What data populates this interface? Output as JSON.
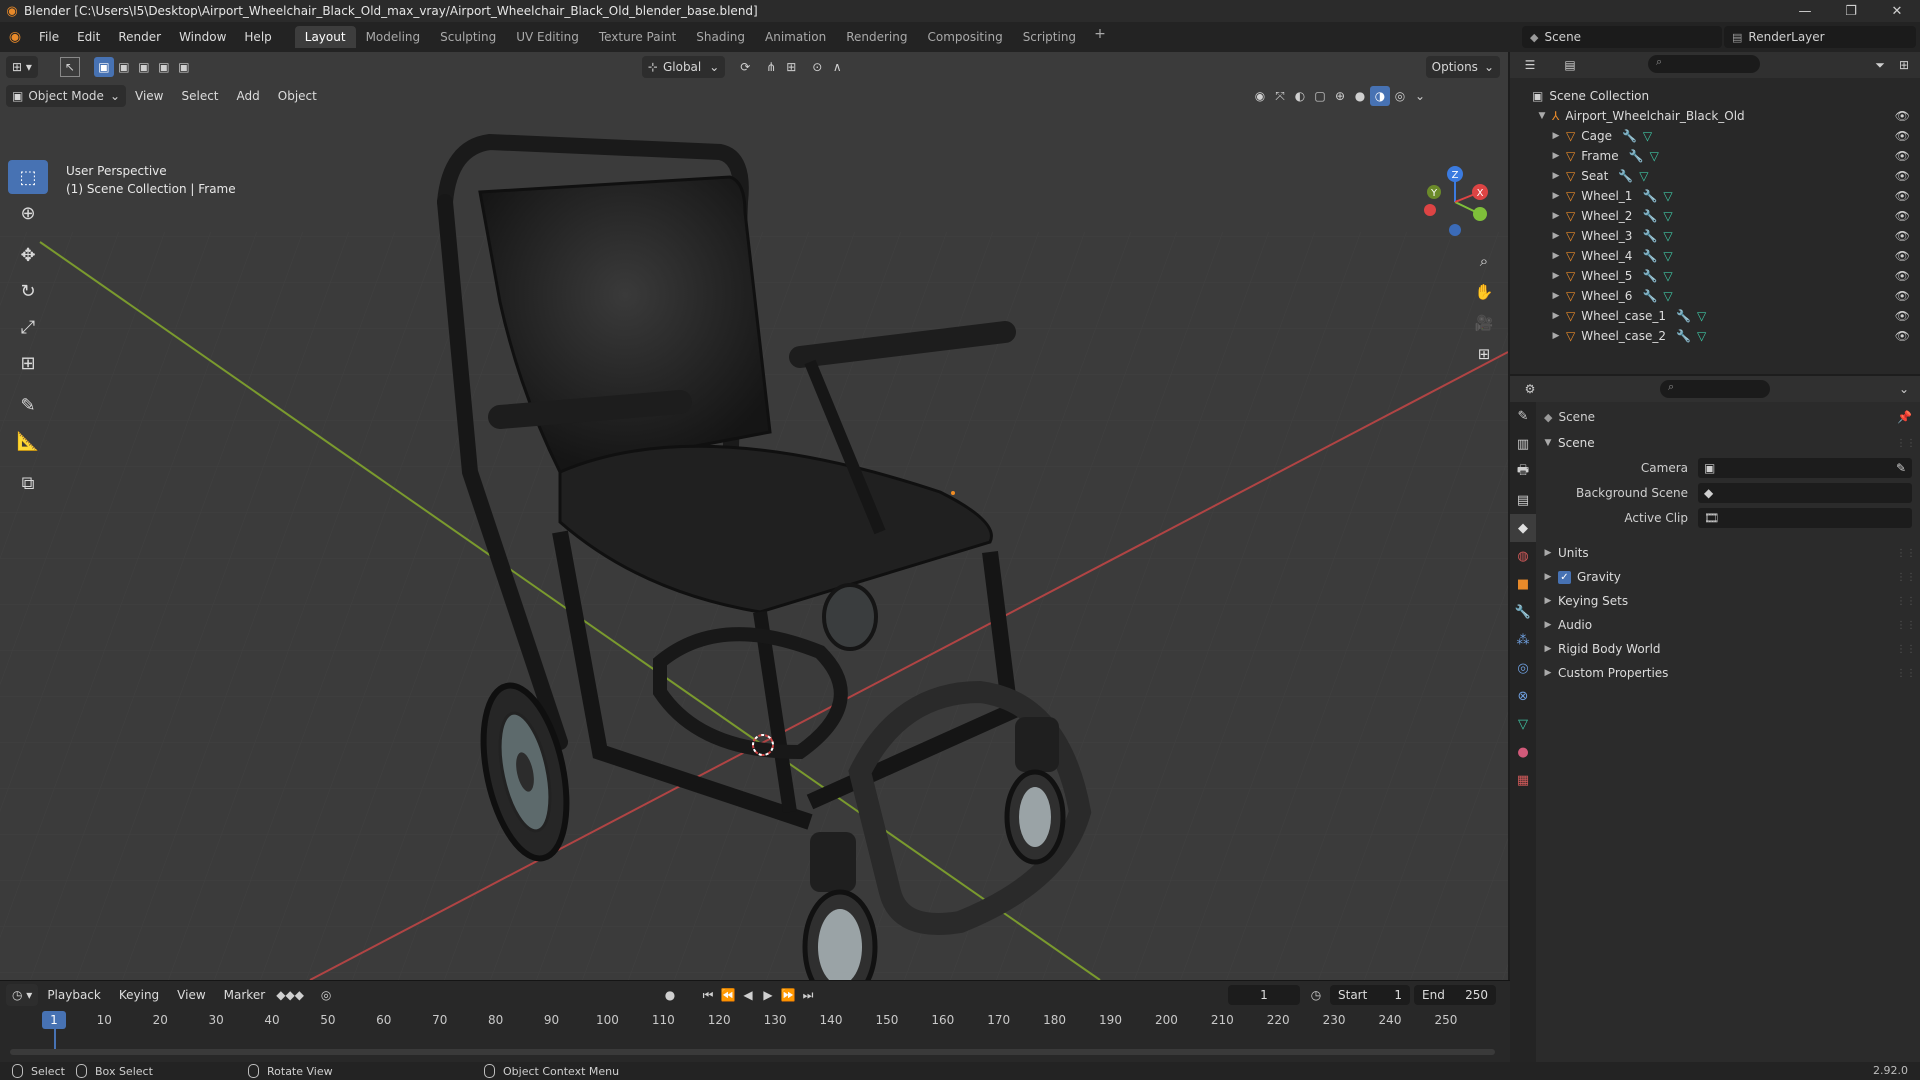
{
  "window": {
    "title": "Blender [C:\\Users\\I5\\Desktop\\Airport_Wheelchair_Black_Old_max_vray/Airport_Wheelchair_Black_Old_blender_base.blend]",
    "controls": [
      "—",
      "❐",
      "✕"
    ]
  },
  "menu": {
    "items": [
      "File",
      "Edit",
      "Render",
      "Window",
      "Help"
    ],
    "workspaces": [
      "Layout",
      "Modeling",
      "Sculpting",
      "UV Editing",
      "Texture Paint",
      "Shading",
      "Animation",
      "Rendering",
      "Compositing",
      "Scripting"
    ],
    "active_workspace": "Layout",
    "scene": "Scene",
    "render_layer": "RenderLayer"
  },
  "viewport": {
    "mode": "Object Mode",
    "menus": [
      "View",
      "Select",
      "Add",
      "Object"
    ],
    "transform_orientation": "Global",
    "options_label": "Options",
    "perspective_label": "User Perspective",
    "collection_label": "(1) Scene Collection | Frame",
    "gizmo_axes": {
      "x": "X",
      "y": "Y",
      "z": "Z"
    },
    "colors": {
      "grid_bg": "#3a3a3a",
      "x_axis": "#c24a4a",
      "y_axis": "#7a9a2e",
      "accent": "#4772b3"
    }
  },
  "outliner": {
    "root": "Scene Collection",
    "collection": "Airport_Wheelchair_Black_Old",
    "objects": [
      "Cage",
      "Frame",
      "Seat",
      "Wheel_1",
      "Wheel_2",
      "Wheel_3",
      "Wheel_4",
      "Wheel_5",
      "Wheel_6",
      "Wheel_case_1",
      "Wheel_case_2"
    ]
  },
  "properties": {
    "context": "Scene",
    "section": "Scene",
    "fields": [
      {
        "label": "Camera",
        "value": ""
      },
      {
        "label": "Background Scene",
        "value": ""
      },
      {
        "label": "Active Clip",
        "value": ""
      }
    ],
    "panels": [
      {
        "label": "Units",
        "checkbox": false
      },
      {
        "label": "Gravity",
        "checkbox": true
      },
      {
        "label": "Keying Sets",
        "checkbox": false
      },
      {
        "label": "Audio",
        "checkbox": false
      },
      {
        "label": "Rigid Body World",
        "checkbox": false
      },
      {
        "label": "Custom Properties",
        "checkbox": false
      }
    ]
  },
  "timeline": {
    "menus": [
      "Playback",
      "Keying",
      "View",
      "Marker"
    ],
    "current_frame": "1",
    "start_label": "Start",
    "start": "1",
    "end_label": "End",
    "end": "250",
    "ticks": [
      "1",
      "10",
      "20",
      "30",
      "40",
      "50",
      "60",
      "70",
      "80",
      "90",
      "100",
      "110",
      "120",
      "130",
      "140",
      "150",
      "160",
      "170",
      "180",
      "190",
      "200",
      "210",
      "220",
      "230",
      "240",
      "250"
    ]
  },
  "statusbar": {
    "select": "Select",
    "box_select": "Box Select",
    "rotate_view": "Rotate View",
    "context_menu": "Object Context Menu",
    "version": "2.92.0"
  }
}
